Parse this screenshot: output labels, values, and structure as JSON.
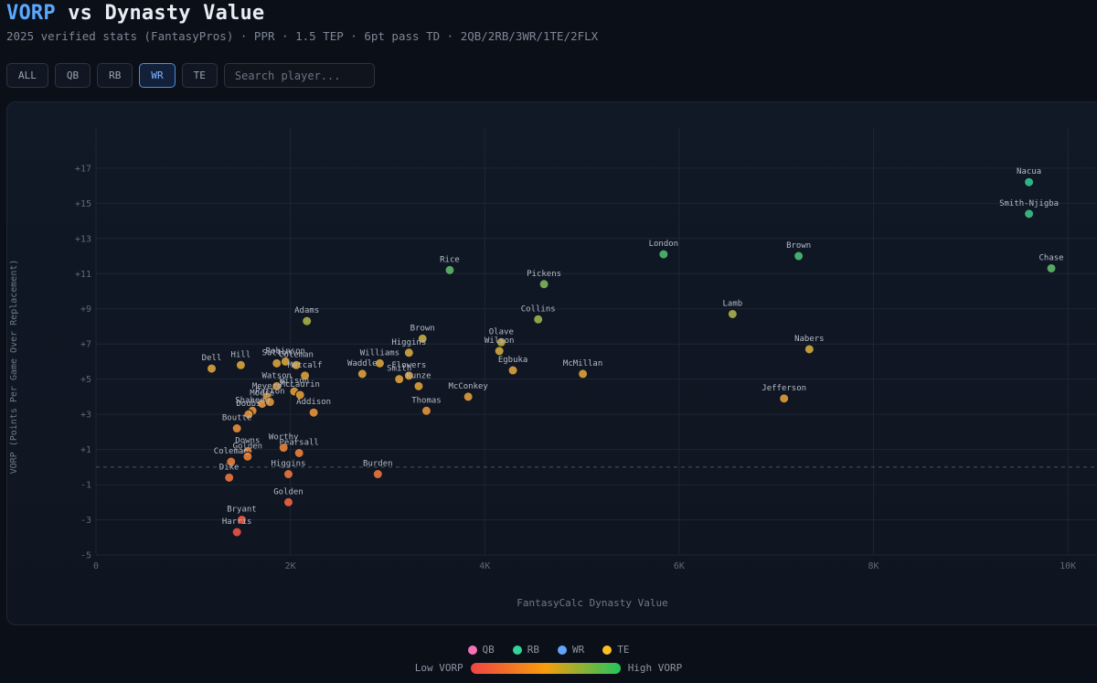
{
  "header": {
    "title_accent": "VORP",
    "title_rest": " vs Dynasty Value",
    "subtitle": "2025 verified stats (FantasyPros) · PPR · 1.5 TEP · 6pt pass TD · 2QB/2RB/3WR/1TE/2FLX"
  },
  "filters": {
    "buttons": [
      {
        "label": "ALL",
        "active": false
      },
      {
        "label": "QB",
        "active": false
      },
      {
        "label": "RB",
        "active": false
      },
      {
        "label": "WR",
        "active": true
      },
      {
        "label": "TE",
        "active": false
      }
    ],
    "search_placeholder": "Search player..."
  },
  "legend": {
    "items": [
      {
        "label": "QB",
        "color": "#f472b6"
      },
      {
        "label": "RB",
        "color": "#34d399"
      },
      {
        "label": "WR",
        "color": "#60a5fa"
      },
      {
        "label": "TE",
        "color": "#fbbf24"
      }
    ],
    "low_label": "Low VORP",
    "high_label": "High VORP"
  },
  "chart_data": {
    "type": "scatter",
    "xlabel": "FantasyCalc Dynasty Value",
    "ylabel": "VORP (Points Per Game Over Replacement)",
    "xlim": [
      0,
      10300
    ],
    "ylim": [
      -5,
      18.5
    ],
    "xticks": [
      0,
      2000,
      4000,
      6000,
      8000,
      10000
    ],
    "xtick_labels": [
      "0",
      "2K",
      "4K",
      "6K",
      "8K",
      "10K"
    ],
    "yticks": [
      -5,
      -3,
      -1,
      1,
      3,
      5,
      7,
      9,
      11,
      13,
      15,
      17
    ],
    "ytick_labels": [
      "-5",
      "-3",
      "-1",
      "+1",
      "+3",
      "+5",
      "+7",
      "+9",
      "+11",
      "+13",
      "+15",
      "+17"
    ],
    "grid": true,
    "baseline": 0,
    "points": [
      {
        "name": "Nacua",
        "x": 9600,
        "y": 16.2,
        "color": "#34c38f"
      },
      {
        "name": "Smith-Njigba",
        "x": 9600,
        "y": 14.4,
        "color": "#3cc08a"
      },
      {
        "name": "Chase",
        "x": 9830,
        "y": 11.3,
        "color": "#5db86a"
      },
      {
        "name": "Brown",
        "x": 7230,
        "y": 12.0,
        "color": "#4cbd72"
      },
      {
        "name": "London",
        "x": 5840,
        "y": 12.1,
        "color": "#4cbd72"
      },
      {
        "name": "Rice",
        "x": 3640,
        "y": 11.2,
        "color": "#5db86a"
      },
      {
        "name": "Pickens",
        "x": 4610,
        "y": 10.4,
        "color": "#7db65a"
      },
      {
        "name": "Lamb",
        "x": 6550,
        "y": 8.7,
        "color": "#a8b04a"
      },
      {
        "name": "Collins",
        "x": 4550,
        "y": 8.4,
        "color": "#9fb24c"
      },
      {
        "name": "Adams",
        "x": 2170,
        "y": 8.3,
        "color": "#a8b04a"
      },
      {
        "name": "Nabers",
        "x": 7340,
        "y": 6.7,
        "color": "#d2a83e"
      },
      {
        "name": "Brown",
        "x": 3360,
        "y": 7.3,
        "color": "#c6ac40"
      },
      {
        "name": "Olave",
        "x": 4170,
        "y": 7.1,
        "color": "#c9ab40"
      },
      {
        "name": "Wilson",
        "x": 4150,
        "y": 6.6,
        "color": "#cfa93f"
      },
      {
        "name": "Higgins",
        "x": 3220,
        "y": 6.5,
        "color": "#d2a83e"
      },
      {
        "name": "Egbuka",
        "x": 4290,
        "y": 5.5,
        "color": "#dba23c"
      },
      {
        "name": "McMillan",
        "x": 5010,
        "y": 5.3,
        "color": "#dba23c"
      },
      {
        "name": "Williams",
        "x": 2920,
        "y": 5.9,
        "color": "#d8a43d"
      },
      {
        "name": "Flowers",
        "x": 3220,
        "y": 5.2,
        "color": "#dda13c"
      },
      {
        "name": "Waddle",
        "x": 2740,
        "y": 5.3,
        "color": "#dda13c"
      },
      {
        "name": "Smith",
        "x": 3120,
        "y": 5.0,
        "color": "#dda13c"
      },
      {
        "name": "Kunze",
        "x": 3320,
        "y": 4.6,
        "color": "#e09e3b"
      },
      {
        "name": "Dell",
        "x": 1190,
        "y": 5.6,
        "color": "#dba23c"
      },
      {
        "name": "Hill",
        "x": 1490,
        "y": 5.8,
        "color": "#d8a43d"
      },
      {
        "name": "Sutton",
        "x": 1860,
        "y": 5.9,
        "color": "#d8a43d"
      },
      {
        "name": "Robinson",
        "x": 1950,
        "y": 6.0,
        "color": "#d8a43d"
      },
      {
        "name": "Coleman",
        "x": 2060,
        "y": 5.8,
        "color": "#d8a43d"
      },
      {
        "name": "Metcalf",
        "x": 2150,
        "y": 5.2,
        "color": "#dda13c"
      },
      {
        "name": "Watson",
        "x": 1860,
        "y": 4.6,
        "color": "#e09e3b"
      },
      {
        "name": "Wilson",
        "x": 2040,
        "y": 4.3,
        "color": "#e09e3b"
      },
      {
        "name": "McLaurin",
        "x": 2100,
        "y": 4.1,
        "color": "#e29b3b"
      },
      {
        "name": "Meyers",
        "x": 1760,
        "y": 4.0,
        "color": "#e29b3b"
      },
      {
        "name": "Moore",
        "x": 1710,
        "y": 3.6,
        "color": "#e4973b"
      },
      {
        "name": "Patton",
        "x": 1790,
        "y": 3.7,
        "color": "#e4973b"
      },
      {
        "name": "Shaheed",
        "x": 1610,
        "y": 3.2,
        "color": "#e6943b"
      },
      {
        "name": "Doubs",
        "x": 1570,
        "y": 3.0,
        "color": "#e6943b"
      },
      {
        "name": "Addison",
        "x": 2240,
        "y": 3.1,
        "color": "#e6943b"
      },
      {
        "name": "McConkey",
        "x": 3830,
        "y": 4.0,
        "color": "#e29b3b"
      },
      {
        "name": "Thomas",
        "x": 3400,
        "y": 3.2,
        "color": "#e6943b"
      },
      {
        "name": "Jefferson",
        "x": 7080,
        "y": 3.9,
        "color": "#e29b3b"
      },
      {
        "name": "Boutte",
        "x": 1450,
        "y": 2.2,
        "color": "#e88e3b"
      },
      {
        "name": "Worthy",
        "x": 1930,
        "y": 1.1,
        "color": "#ea833c"
      },
      {
        "name": "Pearsall",
        "x": 2090,
        "y": 0.8,
        "color": "#ea833c"
      },
      {
        "name": "Downs",
        "x": 1560,
        "y": 0.9,
        "color": "#ea833c"
      },
      {
        "name": "Coleman",
        "x": 1390,
        "y": 0.3,
        "color": "#eb7e3d"
      },
      {
        "name": "Golden",
        "x": 1560,
        "y": 0.6,
        "color": "#ea833c"
      },
      {
        "name": "Dike",
        "x": 1370,
        "y": -0.6,
        "color": "#ec743e"
      },
      {
        "name": "Higgins",
        "x": 1980,
        "y": -0.4,
        "color": "#ec743e"
      },
      {
        "name": "Burden",
        "x": 2900,
        "y": -0.4,
        "color": "#ec743e"
      },
      {
        "name": "Golden",
        "x": 1980,
        "y": -2.0,
        "color": "#ee6440"
      },
      {
        "name": "Bryant",
        "x": 1500,
        "y": -3.0,
        "color": "#ef5a42"
      },
      {
        "name": "Harris",
        "x": 1450,
        "y": -3.7,
        "color": "#f05244"
      }
    ]
  }
}
